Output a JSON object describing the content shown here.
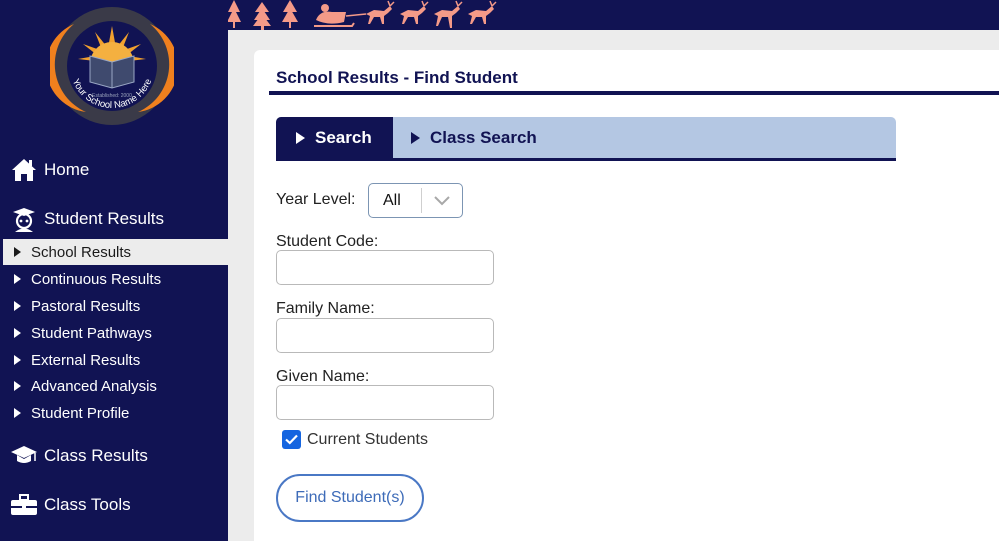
{
  "logo": {
    "ring_text": "Your School Name Here",
    "established": "Established: 2000"
  },
  "sidebar": {
    "home": {
      "label": "Home",
      "icon": "home-icon"
    },
    "student_results": {
      "label": "Student Results",
      "icon": "student-icon"
    },
    "sub_items": [
      {
        "label": "School Results",
        "active": true
      },
      {
        "label": "Continuous Results",
        "active": false
      },
      {
        "label": "Pastoral Results",
        "active": false
      },
      {
        "label": "Student Pathways",
        "active": false
      },
      {
        "label": "External Results",
        "active": false
      },
      {
        "label": "Advanced Analysis",
        "active": false
      },
      {
        "label": "Student Profile",
        "active": false
      }
    ],
    "class_results": {
      "label": "Class Results",
      "icon": "graduation-cap-icon"
    },
    "class_tools": {
      "label": "Class Tools",
      "icon": "toolbox-icon"
    }
  },
  "main": {
    "title": "School Results - Find Student",
    "tabs": [
      {
        "label": "Search",
        "active": true
      },
      {
        "label": "Class Search",
        "active": false
      }
    ],
    "form": {
      "year_level_label": "Year Level:",
      "year_level_value": "All",
      "student_code_label": "Student Code:",
      "student_code_value": "",
      "family_name_label": "Family Name:",
      "family_name_value": "",
      "given_name_label": "Given Name:",
      "given_name_value": "",
      "current_students_label": "Current Students",
      "current_students_checked": true,
      "find_button_label": "Find Student(s)"
    }
  },
  "colors": {
    "navy": "#111353",
    "tab_bar": "#b4c7e3",
    "background": "#ececec",
    "accent_blue": "#4a78c5",
    "logo_orange": "#f0801e",
    "banner_coral": "#f49a88"
  }
}
